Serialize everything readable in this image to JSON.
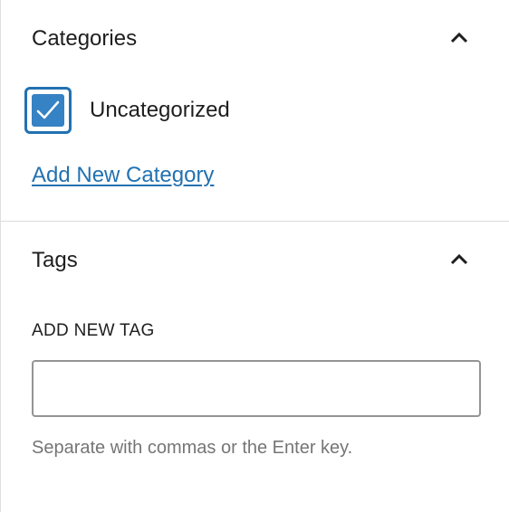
{
  "categories": {
    "title": "Categories",
    "items": [
      {
        "label": "Uncategorized",
        "checked": true
      }
    ],
    "add_new_link": "Add New Category",
    "collapse_icon": "chevron-up-icon"
  },
  "tags": {
    "title": "Tags",
    "add_label": "ADD NEW TAG",
    "input_value": "",
    "help_text": "Separate with commas or the Enter key.",
    "collapse_icon": "chevron-up-icon"
  },
  "colors": {
    "accent": "#2271b1",
    "checkbox_fill": "#3582c4",
    "text": "#1e1e1e",
    "help_text": "#757575",
    "divider": "#dcdcde"
  }
}
